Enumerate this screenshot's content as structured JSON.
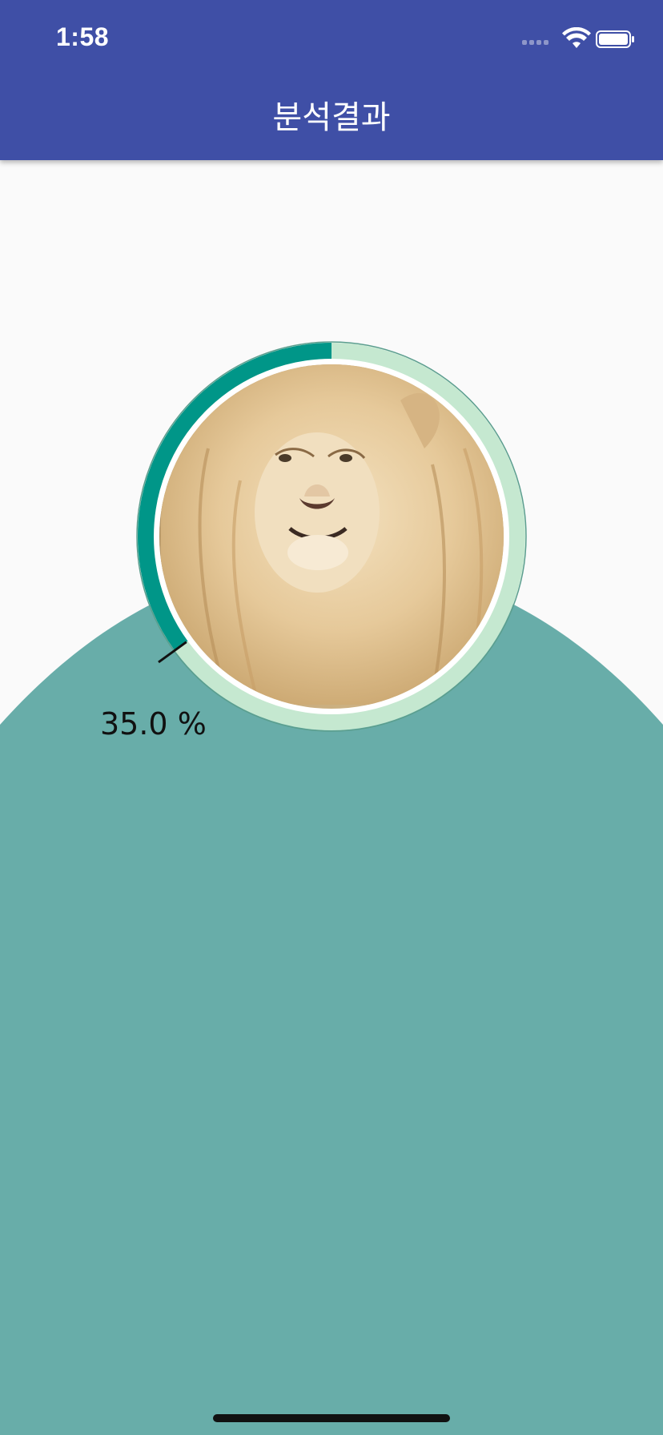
{
  "status_bar": {
    "time": "1:58"
  },
  "app_bar": {
    "title": "분석결과"
  },
  "result": {
    "percent": 35.0,
    "percent_label": "35.0 %",
    "photo": "lion"
  },
  "colors": {
    "app_bar": "#3f4fa6",
    "background": "#fafafa",
    "blob": "#68ada9",
    "ring_track": "#c5e8d0",
    "ring_progress": "#009688"
  }
}
